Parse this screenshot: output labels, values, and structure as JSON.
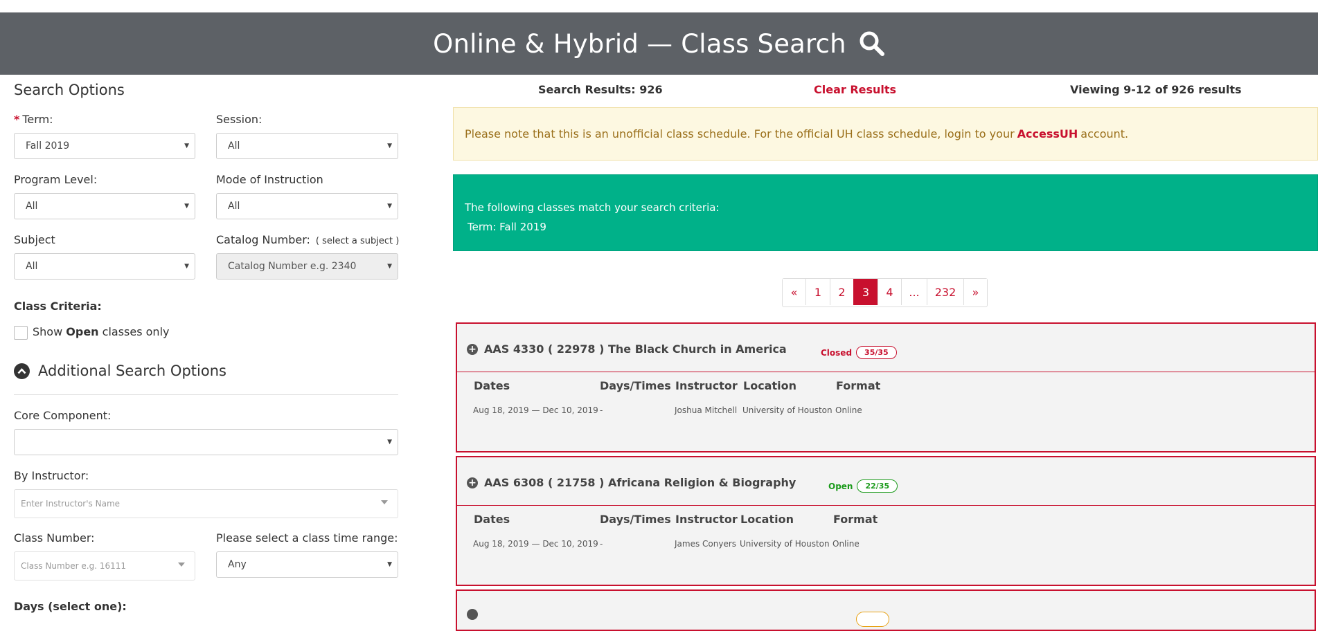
{
  "header": {
    "title": "Online & Hybrid — Class Search"
  },
  "search_options": {
    "heading": "Search Options",
    "term": {
      "label": "Term:",
      "required_mark": "*",
      "value": "Fall 2019"
    },
    "session": {
      "label": "Session:",
      "value": "All"
    },
    "program_level": {
      "label": "Program Level:",
      "value": "All"
    },
    "mode_of_instruction": {
      "label": "Mode of Instruction",
      "value": "All"
    },
    "subject": {
      "label": "Subject",
      "value": "All"
    },
    "catalog_number": {
      "label": "Catalog Number:",
      "hint": "( select a subject )",
      "placeholder": "Catalog Number e.g. 2340"
    },
    "class_criteria": {
      "heading": "Class Criteria:",
      "checkbox_pre": "Show",
      "checkbox_bold": "Open",
      "checkbox_post": "classes only"
    },
    "additional_heading": "Additional Search Options",
    "core_component": {
      "label": "Core Component:",
      "value": ""
    },
    "by_instructor": {
      "label": "By Instructor:",
      "placeholder": "Enter Instructor's Name"
    },
    "class_number": {
      "label": "Class Number:",
      "placeholder": "Class Number e.g. 16111"
    },
    "time_range": {
      "label": "Please select a class time range:",
      "value": "Any"
    },
    "days_heading": "Days (select one):"
  },
  "results": {
    "count_label": "Search Results: 926",
    "clear_label": "Clear Results",
    "viewing_label": "Viewing 9-12 of 926 results",
    "notice_pre": "Please note that this is an unofficial class schedule. For the official UH class schedule, login to your",
    "notice_link": "AccessUH",
    "notice_post": "account.",
    "criteria_intro": "The following classes match your search criteria:",
    "criteria_term": "Term: Fall 2019"
  },
  "pagination": [
    "«",
    "1",
    "2",
    "3",
    "4",
    "...",
    "232",
    "»"
  ],
  "pagination_active": "3",
  "columns": [
    "Dates",
    "Days/Times",
    "Instructor",
    "Location",
    "Format"
  ],
  "classes": [
    {
      "title": "AAS 4330 ( 22978 ) The Black Church in America",
      "status": "Closed",
      "seats": "35/35",
      "dates": "Aug 18, 2019 — Dec 10, 2019",
      "days_times": "-",
      "instructor": "Joshua Mitchell",
      "location": "University of Houston",
      "format": "Online"
    },
    {
      "title": "AAS 6308 ( 21758 ) Africana Religion & Biography",
      "status": "Open",
      "seats": "22/35",
      "dates": "Aug 18, 2019 — Dec 10, 2019",
      "days_times": "-",
      "instructor": "James Conyers",
      "location": "University of Houston",
      "format": "Online"
    }
  ],
  "colors": {
    "accent": "#c8102e",
    "header_bg": "#5d6166",
    "success": "#00b189",
    "open": "#1a9a1a"
  }
}
